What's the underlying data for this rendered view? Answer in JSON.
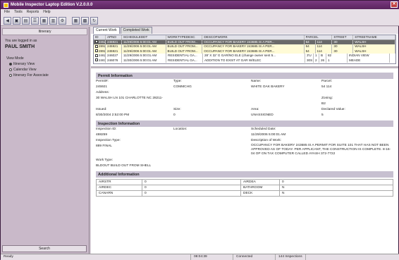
{
  "window": {
    "title": "Mobile Inspector Laptop Edition V.2.0.0.0"
  },
  "menu": [
    "File",
    "Tools",
    "Reports",
    "Help"
  ],
  "toolbar": {
    "icons": [
      "back-icon",
      "save-icon",
      "print-icon",
      "list-icon",
      "map-icon",
      "report-icon",
      "settings-icon",
      "grid-icon",
      "calendar-icon",
      "refresh-icon"
    ]
  },
  "sidebar": {
    "header": "Itinerary",
    "logged_label": "You are logged in as",
    "user": "PAUL SMITH",
    "view_mode_label": "View Mode",
    "options": [
      {
        "label": "Itinerary View",
        "selected": true
      },
      {
        "label": "Calendar View",
        "selected": false
      },
      {
        "label": "Itinerary For Associate",
        "selected": false
      }
    ],
    "search": "Search"
  },
  "tabs": [
    "Current Work",
    "Completed Work"
  ],
  "grid": {
    "columns": [
      "ID",
      "APNO",
      "SCHEDULEDDT",
      "WORKTYPEDESC",
      "DESCOFWORK",
      "PARCEL",
      "STREET",
      "STREETNAME"
    ],
    "rows": [
      [
        "24521",
        "245921",
        "11/29/2006 5:00:01 AM",
        "BUILD OUT FROM...",
        "OCCUPANCY FOR BAKERY 243685 IS A PER...",
        "54",
        "114",
        "30",
        "WALSH"
      ],
      [
        "28924",
        "245921",
        "11/29/2006 5:00:01 AM",
        "BUILD OUT FROM...",
        "OCCUPANCY FOR BAKERY 243685 IS A PER...",
        "54",
        "114",
        "30",
        "WALSH"
      ],
      [
        "28924",
        "245921",
        "11/29/2006 5:00:01 AM",
        "BUILD OUT FROM...",
        "OCCUPANCY FOR BAKERY 243685 IS A PER...",
        "54",
        "114",
        "30",
        "WALSH"
      ],
      [
        "24627",
        "246027",
        "11/29/2006 5:00:01 AM",
        "RESIDENTIAL GA...",
        "28' X 32' G GAR/NO ELE  (change owner sent 5...",
        "3'U",
        "1",
        "B",
        "82",
        "INDIAN VIEW"
      ],
      [
        "24676",
        "246076",
        "11/30/2006 5:00:01 AM",
        "RESIDENTIAL GA...",
        "ADDITION TO EXIST AT GAR W/ELEC",
        "30S",
        "2",
        "26",
        "1",
        "MEADE"
      ]
    ]
  },
  "permit": {
    "title": "Permit Information",
    "permit_label": "Permit#:",
    "permit": "245921",
    "type_label": "Type:",
    "type": "COMMCHG",
    "name_label": "Name:",
    "name": "WHITE OAK BAKERY",
    "parcel_label": "Parcel:",
    "parcel": "54 114",
    "address_label": "Address:",
    "address": "30  WALSH LN 101 CHARLOTTE NC 28211-",
    "zoning_label": "Zoning:",
    "zoning": "B2",
    "issued_label": "Issued:",
    "issued": "8/30/2004 2:52:00 PM",
    "size_label": "Size:",
    "size": "0",
    "area_label": "Area:",
    "area": "UNASSIGNED",
    "declared_label": "Declared Value:",
    "declared": "5"
  },
  "inspection": {
    "title": "Inspection Information",
    "id_label": "Inspection ID:",
    "id": "488259",
    "location_label": "Location:",
    "sched_label": "Scheduled Date:",
    "sched": "11/29/2006 5:00:01 AM",
    "type_label": "Inspection Type:",
    "type": "889  FINAL",
    "desc_label": "Description of Work:",
    "desc": "OCCUPANCY FOR BAKERY 243685 IS A PERMIT FOR SUITE 101 THAT HAS NOT BEEN APPROVED AS OF TODAY. PER APPLICANT, THE CONSTRUCTION IS COMPLETE. 8-16-04 OP ON TAX COMPUTER CALLED AYASH 372-7722",
    "worktype_label": "Work Type:",
    "worktype": "BLDOUT  BUILD OUT FROM SHELL"
  },
  "additional": {
    "title": "Additional Information",
    "rows": [
      [
        "AIRSTR",
        "0",
        "AIRDEA",
        "0"
      ],
      [
        "AIRDEC",
        "0",
        "BATHROOM",
        "N"
      ],
      [
        "CANARN",
        "0",
        "DECK",
        "N"
      ]
    ]
  },
  "status": [
    "Ready",
    "08:04:39",
    "Connected",
    "144 Inspections"
  ]
}
